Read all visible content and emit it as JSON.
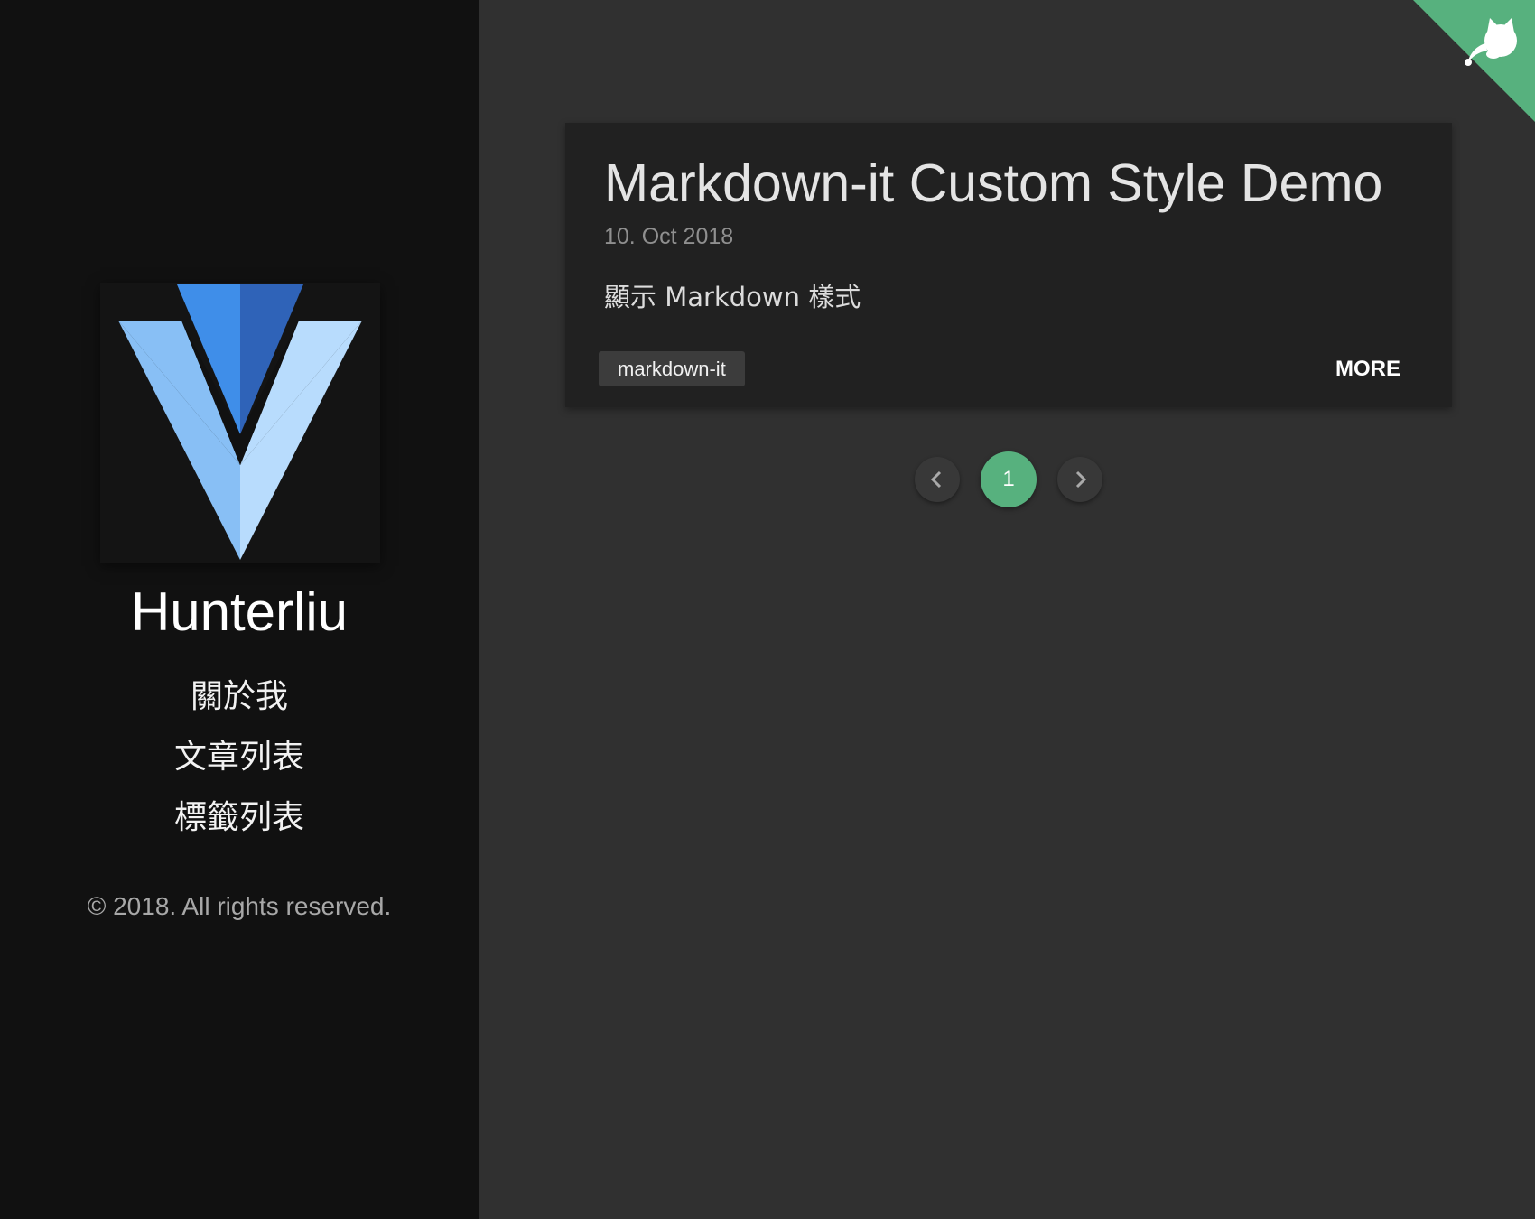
{
  "sidebar": {
    "logo_icon": "vue-style-v-logo",
    "site_name": "Hunterliu",
    "nav": [
      {
        "label": "關於我"
      },
      {
        "label": "文章列表"
      },
      {
        "label": "標籤列表"
      }
    ],
    "copyright": "© 2018. All rights reserved."
  },
  "corner": {
    "icon": "github-octocat-icon",
    "color": "#57b17e"
  },
  "post": {
    "title": "Markdown-it Custom Style Demo",
    "date": "10. Oct 2018",
    "description": "顯示 Markdown 樣式",
    "tag": "markdown-it",
    "more_label": "MORE"
  },
  "pagination": {
    "prev_icon": "chevron-left-icon",
    "current_page": "1",
    "next_icon": "chevron-right-icon",
    "active_color": "#57b17e"
  }
}
